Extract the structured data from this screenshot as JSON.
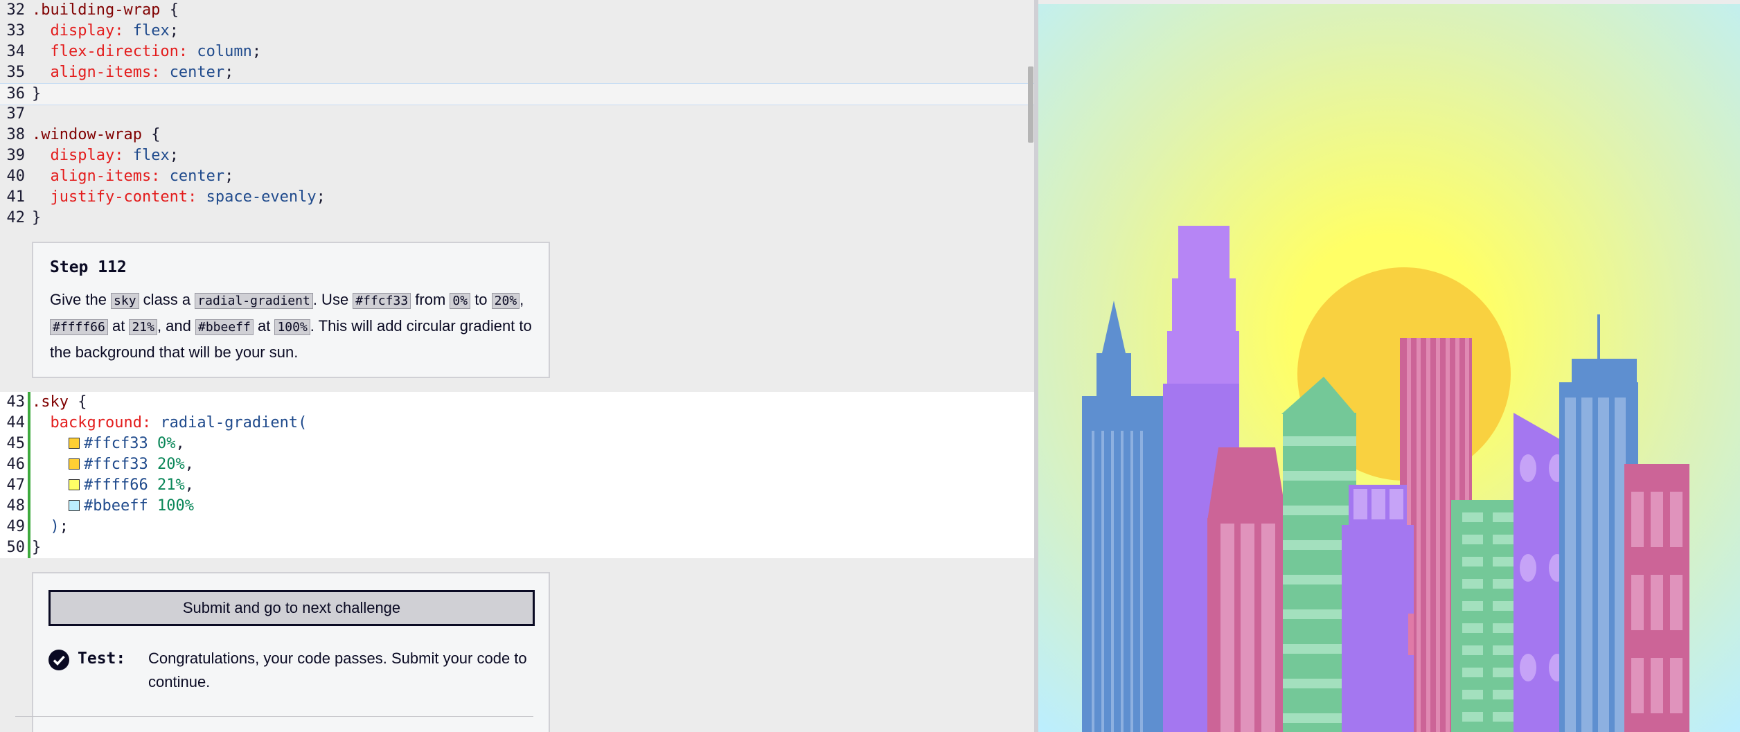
{
  "code_top": [
    {
      "ln": "32",
      "parts": [
        [
          "sel",
          ".building-wrap "
        ],
        [
          "punct",
          "{"
        ]
      ]
    },
    {
      "ln": "33",
      "parts": [
        [
          "prop",
          "  display: "
        ],
        [
          "val",
          "flex"
        ],
        [
          "punct",
          ";"
        ]
      ]
    },
    {
      "ln": "34",
      "parts": [
        [
          "prop",
          "  flex-direction: "
        ],
        [
          "val",
          "column"
        ],
        [
          "punct",
          ";"
        ]
      ]
    },
    {
      "ln": "35",
      "parts": [
        [
          "prop",
          "  align-items: "
        ],
        [
          "val",
          "center"
        ],
        [
          "punct",
          ";"
        ]
      ]
    },
    {
      "ln": "36",
      "parts": [
        [
          "punct",
          "}"
        ]
      ]
    },
    {
      "ln": "37",
      "parts": []
    },
    {
      "ln": "38",
      "parts": [
        [
          "sel",
          ".window-wrap "
        ],
        [
          "punct",
          "{"
        ]
      ]
    },
    {
      "ln": "39",
      "parts": [
        [
          "prop",
          "  display: "
        ],
        [
          "val",
          "flex"
        ],
        [
          "punct",
          ";"
        ]
      ]
    },
    {
      "ln": "40",
      "parts": [
        [
          "prop",
          "  align-items: "
        ],
        [
          "val",
          "center"
        ],
        [
          "punct",
          ";"
        ]
      ]
    },
    {
      "ln": "41",
      "parts": [
        [
          "prop",
          "  justify-content: "
        ],
        [
          "val",
          "space-evenly"
        ],
        [
          "punct",
          ";"
        ]
      ]
    },
    {
      "ln": "42",
      "parts": [
        [
          "punct",
          "}"
        ]
      ]
    }
  ],
  "code_editable": [
    {
      "ln": "43",
      "parts": [
        [
          "sel",
          ".sky "
        ],
        [
          "punct",
          "{"
        ]
      ]
    },
    {
      "ln": "44",
      "parts": [
        [
          "prop",
          "  background: "
        ],
        [
          "val",
          "radial-gradient("
        ]
      ]
    },
    {
      "ln": "45",
      "swatch": "#ffcf33",
      "parts": [
        [
          "val",
          "#ffcf33 "
        ],
        [
          "num",
          "0%"
        ],
        [
          "punct",
          ","
        ]
      ]
    },
    {
      "ln": "46",
      "swatch": "#ffcf33",
      "parts": [
        [
          "val",
          "#ffcf33 "
        ],
        [
          "num",
          "20%"
        ],
        [
          "punct",
          ","
        ]
      ]
    },
    {
      "ln": "47",
      "swatch": "#ffff66",
      "parts": [
        [
          "val",
          "#ffff66 "
        ],
        [
          "num",
          "21%"
        ],
        [
          "punct",
          ","
        ]
      ]
    },
    {
      "ln": "48",
      "swatch": "#bbeeff",
      "parts": [
        [
          "val",
          "#bbeeff "
        ],
        [
          "num",
          "100%"
        ]
      ]
    },
    {
      "ln": "49",
      "parts": [
        [
          "val",
          "  )"
        ],
        [
          "punct",
          ";"
        ]
      ]
    },
    {
      "ln": "50",
      "parts": [
        [
          "punct",
          "}"
        ]
      ]
    }
  ],
  "step": {
    "title": "Step 112",
    "description": [
      [
        "text",
        "Give the "
      ],
      [
        "code",
        "sky"
      ],
      [
        "text",
        " class a "
      ],
      [
        "code",
        "radial-gradient"
      ],
      [
        "text",
        ". Use "
      ],
      [
        "code",
        "#ffcf33"
      ],
      [
        "text",
        " from "
      ],
      [
        "code",
        "0%"
      ],
      [
        "text",
        " to "
      ],
      [
        "code",
        "20%"
      ],
      [
        "text",
        ", "
      ],
      [
        "code",
        "#ffff66"
      ],
      [
        "text",
        " at "
      ],
      [
        "code",
        "21%"
      ],
      [
        "text",
        ", and "
      ],
      [
        "code",
        "#bbeeff"
      ],
      [
        "text",
        " at "
      ],
      [
        "code",
        "100%"
      ],
      [
        "text",
        ". This will add circular gradient to the background that will be your sun."
      ]
    ]
  },
  "actions": {
    "submit_label": "Submit and go to next challenge",
    "test_label": "Test:",
    "test_message": "Congratulations, your code passes. Submit your code to continue."
  },
  "colors": {
    "ffcf33": "#ffcf33",
    "ffff66": "#ffff66",
    "bbeeff": "#bbeeff",
    "editor_green": "#3eaa3e"
  }
}
